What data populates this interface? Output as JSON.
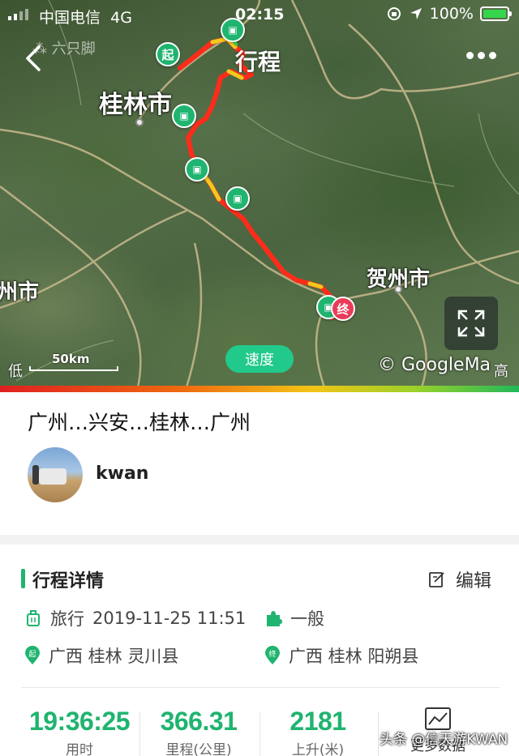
{
  "status_bar": {
    "carrier": "中国电信",
    "network": "4G",
    "time": "02:15",
    "battery": "100%"
  },
  "nav": {
    "title": "行程",
    "app_mark": "六只脚"
  },
  "map": {
    "cities": {
      "guilin": "桂林市",
      "hezhou": "贺州市",
      "left_city": "州市"
    },
    "start_marker": "起",
    "end_marker": "终",
    "speed_button": "速度",
    "scale_label": "50km",
    "legend_low": "低",
    "legend_high": "高",
    "attribution": "© GoogleMa"
  },
  "trip": {
    "title": "广州…兴安…桂林…广州",
    "user": "kwan"
  },
  "details": {
    "section_title": "行程详情",
    "edit_label": "编辑",
    "type": "旅行",
    "datetime": "2019-11-25 11:51",
    "difficulty": "一般",
    "start_location": "广西 桂林 灵川县",
    "end_location": "广西 桂林 阳朔县",
    "start_badge": "起",
    "end_badge": "终"
  },
  "stats": [
    {
      "value": "19:36:25",
      "label": "用时"
    },
    {
      "value": "366.31",
      "label": "里程(公里)"
    },
    {
      "value": "2181",
      "label": "上升(米)"
    }
  ],
  "more_data_label": "更多数据",
  "watermark": "头条 @信天游KWAN",
  "colors": {
    "accent": "#1fb46f",
    "end": "#ea3b5a"
  }
}
